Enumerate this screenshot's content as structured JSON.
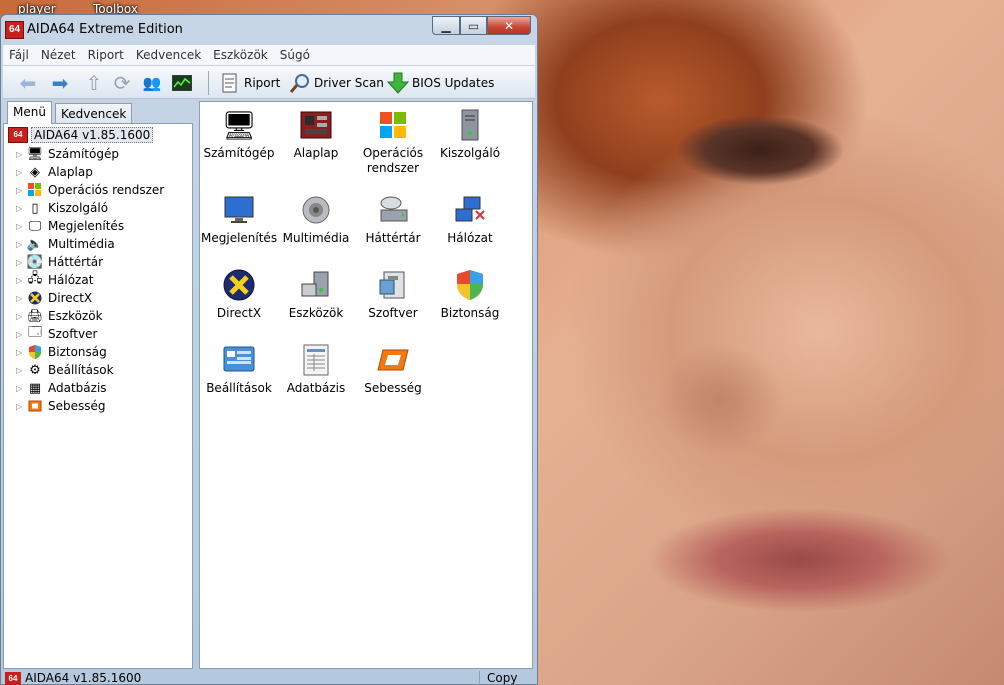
{
  "desktop": {
    "labels": [
      "player",
      "Toolbox"
    ]
  },
  "window": {
    "title": "AIDA64 Extreme Edition",
    "app_badge": "64",
    "controls": {
      "minimize": "▁",
      "maximize": "▭",
      "close": "✕"
    }
  },
  "menubar": {
    "items": [
      "Fájl",
      "Nézet",
      "Riport",
      "Kedvencek",
      "Eszközök",
      "Súgó"
    ]
  },
  "toolbar": {
    "riport": "Riport",
    "driver_scan": "Driver Scan",
    "bios_updates": "BIOS Updates"
  },
  "tabs": [
    "Menü",
    "Kedvencek"
  ],
  "tree": {
    "root": "AIDA64 v1.85.1600",
    "items": [
      "Számítógép",
      "Alaplap",
      "Operációs rendszer",
      "Kiszolgáló",
      "Megjelenítés",
      "Multimédia",
      "Háttértár",
      "Hálózat",
      "DirectX",
      "Eszközök",
      "Szoftver",
      "Biztonság",
      "Beállítások",
      "Adatbázis",
      "Sebesség"
    ]
  },
  "content": {
    "items": [
      [
        "Számítógép"
      ],
      [
        "Alaplap"
      ],
      [
        "Operációs",
        "rendszer"
      ],
      [
        "Kiszolgáló"
      ],
      [
        "Megjelenítés"
      ],
      [
        "Multimédia"
      ],
      [
        "Háttértár"
      ],
      [
        "Hálózat"
      ],
      [
        "DirectX"
      ],
      [
        "Eszközök"
      ],
      [
        "Szoftver"
      ],
      [
        "Biztonság"
      ],
      [
        "Beállítások"
      ],
      [
        "Adatbázis"
      ],
      [
        "Sebesség"
      ]
    ]
  },
  "statusbar": {
    "left": "AIDA64 v1.85.1600",
    "right": "Copy"
  },
  "colors": {
    "accent": "#c8201c",
    "window_frame": "#c7d6e6",
    "panel_border": "#8e9fb4"
  }
}
